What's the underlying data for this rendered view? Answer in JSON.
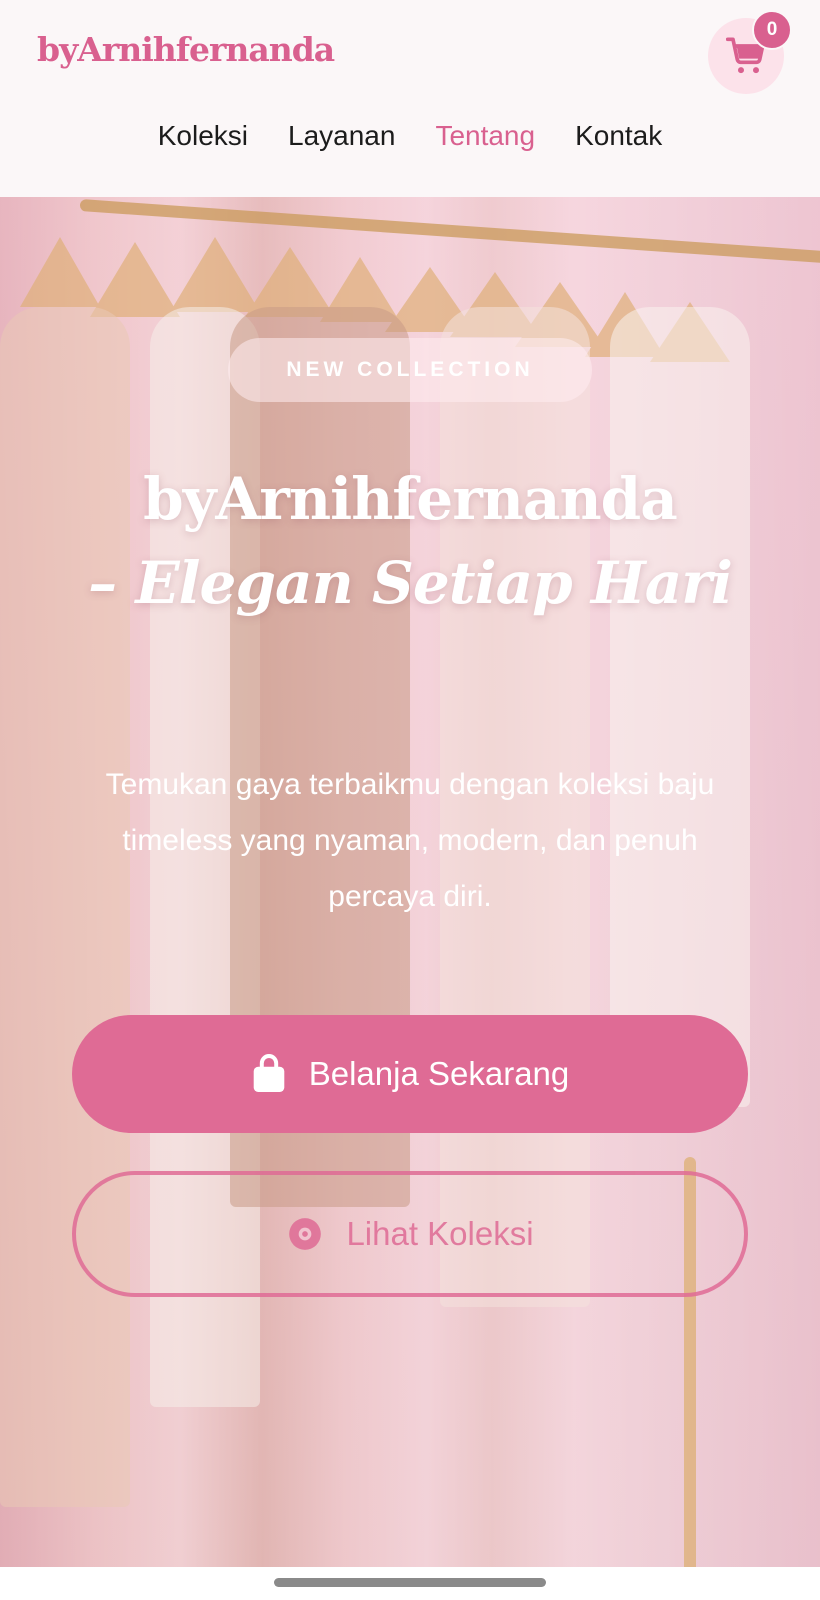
{
  "header": {
    "brand": "byArnihfernanda",
    "cart": {
      "icon": "shopping-cart-icon",
      "count": "0"
    },
    "nav": [
      {
        "label": "Koleksi",
        "active": false
      },
      {
        "label": "Layanan",
        "active": false
      },
      {
        "label": "Tentang",
        "active": true
      },
      {
        "label": "Kontak",
        "active": false
      }
    ]
  },
  "hero": {
    "badge": "NEW COLLECTION",
    "title_line1": "byArnihfernanda",
    "title_accent": "– Elegan Setiap Hari",
    "subtitle": "Temukan gaya terbaikmu dengan koleksi baju timeless yang nyaman, modern, dan penuh percaya diri.",
    "primary_button": {
      "label": "Belanja Sekarang",
      "icon": "shopping-bag-icon"
    },
    "secondary_button": {
      "label": "Lihat Koleksi",
      "icon": "eye-icon"
    }
  },
  "colors": {
    "brand": "#d9608f",
    "button": "#df6b95",
    "cart_bg": "#fce2ea"
  }
}
